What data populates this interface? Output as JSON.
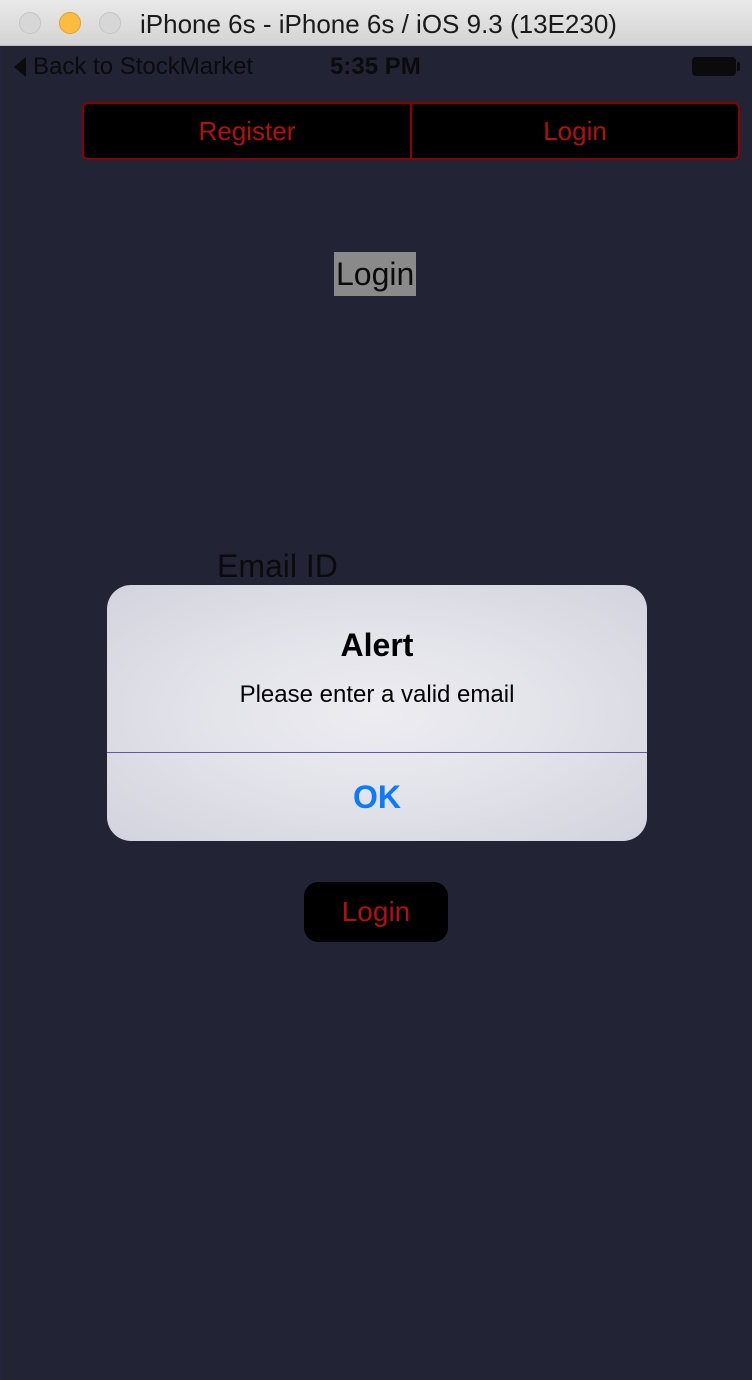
{
  "window": {
    "title": "iPhone 6s - iPhone 6s / iOS 9.3 (13E230)"
  },
  "status_bar": {
    "back_label": "Back to StockMarket",
    "time": "5:35 PM"
  },
  "segmented_control": {
    "items": [
      {
        "label": "Register"
      },
      {
        "label": "Login"
      }
    ]
  },
  "main": {
    "heading": "Login",
    "email_label": "Email ID",
    "login_button": "Login"
  },
  "alert": {
    "title": "Alert",
    "message": "Please enter a valid email",
    "ok_label": "OK"
  },
  "colors": {
    "background": "#222335",
    "accent_red": "#b40e0e",
    "alert_action_blue": "#0a7aff",
    "traffic_light_minimize": "#fdbc40"
  }
}
